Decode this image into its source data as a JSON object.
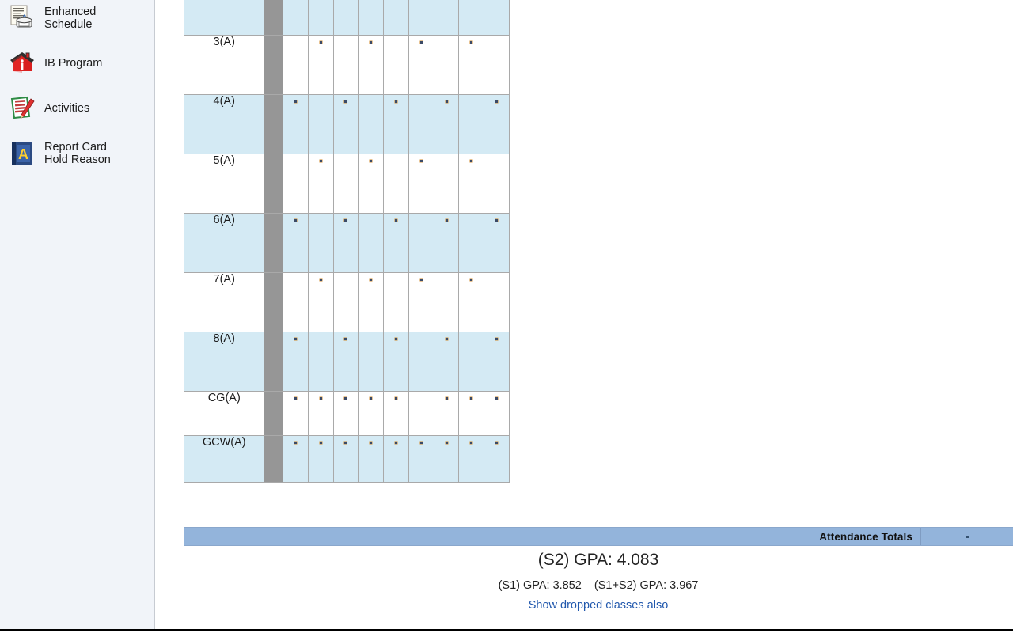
{
  "sidebar": {
    "items": [
      {
        "label": "Enhanced\nSchedule",
        "icon": "schedule-print-icon"
      },
      {
        "label": "IB Program",
        "icon": "house-info-icon"
      },
      {
        "label": "Activities",
        "icon": "notepad-pencil-icon"
      },
      {
        "label": "Report Card\nHold Reason",
        "icon": "blue-book-a-icon"
      }
    ]
  },
  "schedule_table": {
    "column_count": 9,
    "rows": [
      {
        "period": "",
        "marks": [
          0,
          0,
          0,
          0,
          0,
          0,
          0,
          0,
          0
        ],
        "shade": "alt",
        "partial": true
      },
      {
        "period": "3(A)",
        "marks": [
          0,
          1,
          0,
          1,
          0,
          1,
          0,
          1,
          0
        ],
        "shade": "base"
      },
      {
        "period": "4(A)",
        "marks": [
          1,
          0,
          1,
          0,
          1,
          0,
          1,
          0,
          1
        ],
        "shade": "alt"
      },
      {
        "period": "5(A)",
        "marks": [
          0,
          1,
          0,
          1,
          0,
          1,
          0,
          1,
          0
        ],
        "shade": "base"
      },
      {
        "period": "6(A)",
        "marks": [
          1,
          0,
          1,
          0,
          1,
          0,
          1,
          0,
          1
        ],
        "shade": "alt"
      },
      {
        "period": "7(A)",
        "marks": [
          0,
          1,
          0,
          1,
          0,
          1,
          0,
          1,
          0
        ],
        "shade": "base"
      },
      {
        "period": "8(A)",
        "marks": [
          1,
          0,
          1,
          0,
          1,
          0,
          1,
          0,
          1
        ],
        "shade": "alt"
      },
      {
        "period": "CG(A)",
        "marks": [
          1,
          1,
          1,
          1,
          1,
          0,
          1,
          1,
          1
        ],
        "shade": "base"
      },
      {
        "period": "GCW(A)",
        "marks": [
          1,
          1,
          1,
          1,
          1,
          1,
          1,
          1,
          1
        ],
        "shade": "alt"
      }
    ]
  },
  "attendance": {
    "label": "Attendance Totals",
    "value": "."
  },
  "gpa": {
    "main": "(S2) GPA: 4.083",
    "s1": "(S1) GPA: 3.852",
    "combined": "(S1+S2) GPA: 3.967",
    "show_dropped_link": "Show dropped classes also"
  },
  "colors": {
    "row_shade": "#d4eaf4",
    "attendance_bar": "#93b4db",
    "link": "#2158ad",
    "gutter": "#969696",
    "sidebar_bg": "#f1f4f9"
  }
}
